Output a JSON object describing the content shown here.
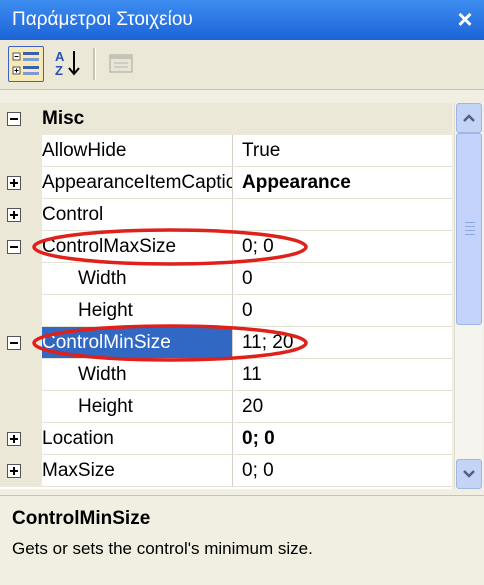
{
  "window": {
    "title": "Παράμετροι Στοιχείου",
    "close_glyph": "×"
  },
  "toolbar": {
    "categorized_icon": "categorized-view-icon",
    "alphabetical_icon": "alphabetical-sort-icon",
    "property_pages_icon": "property-pages-icon"
  },
  "grid": {
    "category": "Misc",
    "rows": [
      {
        "name": "AllowHide",
        "value": "True"
      },
      {
        "name": "AppearanceItemCaption",
        "value": "Appearance"
      },
      {
        "name": "Control",
        "value": ""
      },
      {
        "name": "ControlMaxSize",
        "value": "0; 0"
      },
      {
        "name": "Width",
        "value": "0"
      },
      {
        "name": "Height",
        "value": "0"
      },
      {
        "name": "ControlMinSize",
        "value": "11; 20"
      },
      {
        "name": "Width",
        "value": "11"
      },
      {
        "name": "Height",
        "value": "20"
      },
      {
        "name": "Location",
        "value": "0; 0"
      },
      {
        "name": "MaxSize",
        "value": "0; 0"
      }
    ],
    "selected": "ControlMinSize"
  },
  "description": {
    "title": "ControlMinSize",
    "text": "Gets or sets the control's minimum size."
  },
  "colors": {
    "titlebar": "#2a6fe0",
    "selection": "#3168c4",
    "annotation": "#e0201a"
  }
}
